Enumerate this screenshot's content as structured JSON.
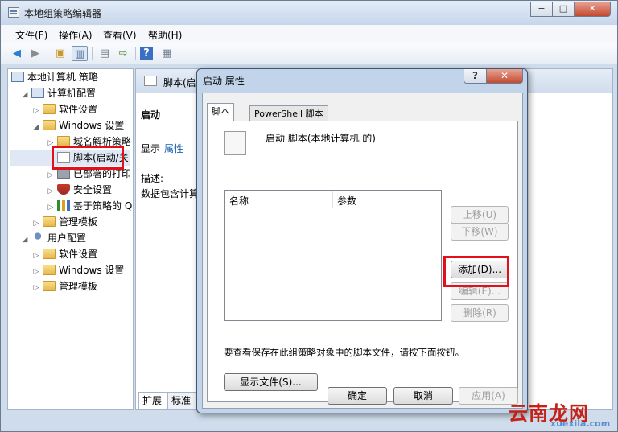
{
  "window": {
    "title": "本地组策略编辑器",
    "controls": [
      "−",
      "□",
      "✕"
    ]
  },
  "menu": [
    "文件(F)",
    "操作(A)",
    "查看(V)",
    "帮助(H)"
  ],
  "toolbar": {
    "icons": [
      "back-arrow-icon",
      "forward-arrow-icon",
      "up-folder-icon",
      "show-hide-tree-icon",
      "properties-icon",
      "export-list-icon",
      "help-icon",
      "view-icon"
    ]
  },
  "tree": {
    "root": "本地计算机 策略",
    "computer": "计算机配置",
    "software": "软件设置",
    "windows": "Windows 设置",
    "dns": "域名解析策略",
    "scripts": "脚本(启动/关",
    "printers": "已部署的打印",
    "security": "安全设置",
    "qos": "基于策略的 Q",
    "admin": "管理模板",
    "user": "用户配置",
    "u_software": "软件设置",
    "u_windows": "Windows 设置",
    "u_admin": "管理模板"
  },
  "right": {
    "header": "脚本(启",
    "section": "启动",
    "show": "显示",
    "properties_link": "属性",
    "desc_label": "描述:",
    "desc_text": "数据包含计算",
    "tabs": [
      "扩展",
      "标准"
    ]
  },
  "dialog": {
    "title": "启动 属性",
    "help": "?",
    "close": "✕",
    "tabs": [
      "脚本",
      "PowerShell 脚本"
    ],
    "heading": "启动 脚本(本地计算机 的)",
    "columns": [
      "名称",
      "参数"
    ],
    "buttons": {
      "up": "上移(U)",
      "down": "下移(W)",
      "add": "添加(D)...",
      "edit": "编辑(E)...",
      "remove": "删除(R)"
    },
    "info": "要查看保存在此组策略对象中的脚本文件，请按下面按钮。",
    "show_files": "显示文件(S)...",
    "ok": "确定",
    "cancel": "取消",
    "apply": "应用(A)"
  },
  "watermark": {
    "main": "云南龙网",
    "sub": "xuexila.com"
  }
}
